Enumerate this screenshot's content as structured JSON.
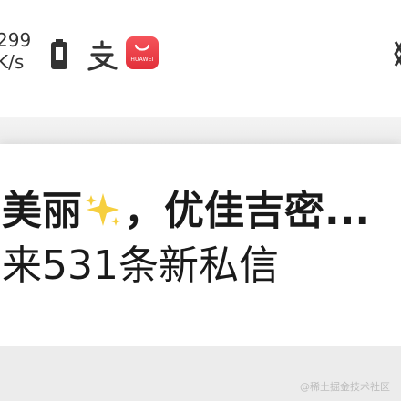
{
  "status_bar": {
    "net_speed_value": "299",
    "net_speed_unit": "K/s",
    "icons": [
      "battery-icon",
      "alipay-icon",
      "huawei-appgallery-icon"
    ],
    "app_badge_label": "HUAWEI",
    "brand_color": "#e5343d"
  },
  "notification": {
    "line1_before_emoji": "美丽",
    "emoji": "sparkles",
    "line1_after_emoji": "，优佳吉密...",
    "line2": "来531条新私信"
  },
  "watermark": "@稀土掘金技术社区"
}
